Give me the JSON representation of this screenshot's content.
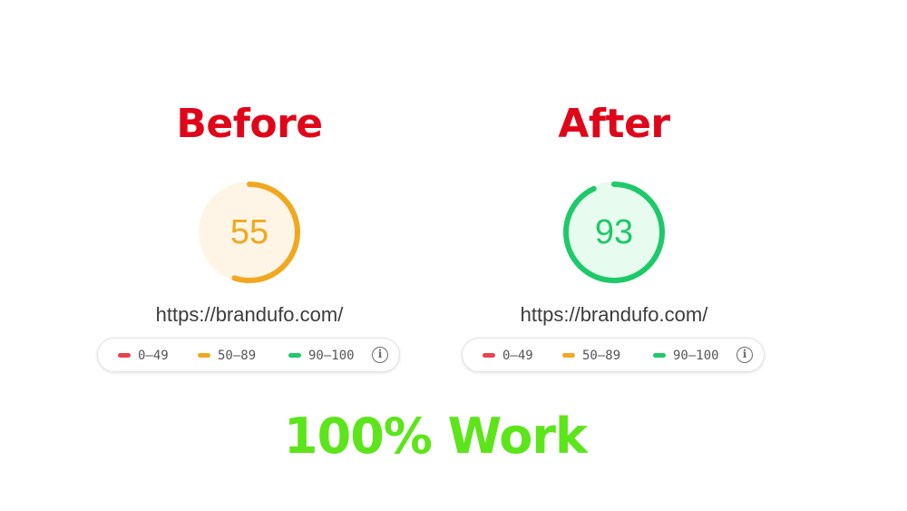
{
  "colors": {
    "heading": "#e0061a",
    "fail": "#e8434f",
    "average": "#f0a820",
    "pass": "#1ec96a",
    "footer": "#5ce51a"
  },
  "before": {
    "heading": "Before",
    "score": "55",
    "score_fraction": 0.55,
    "gauge_color": "#f0a820",
    "gauge_fill": "#fff5e6",
    "url": "https://brandufo.com/"
  },
  "after": {
    "heading": "After",
    "score": "93",
    "score_fraction": 0.93,
    "gauge_color": "#1ec96a",
    "gauge_fill": "#e8fbef",
    "url": "https://brandufo.com/"
  },
  "legend": {
    "fail": "0–49",
    "average": "50–89",
    "pass": "90–100",
    "info_icon": "info-icon"
  },
  "footer": {
    "text": "100% Work"
  }
}
